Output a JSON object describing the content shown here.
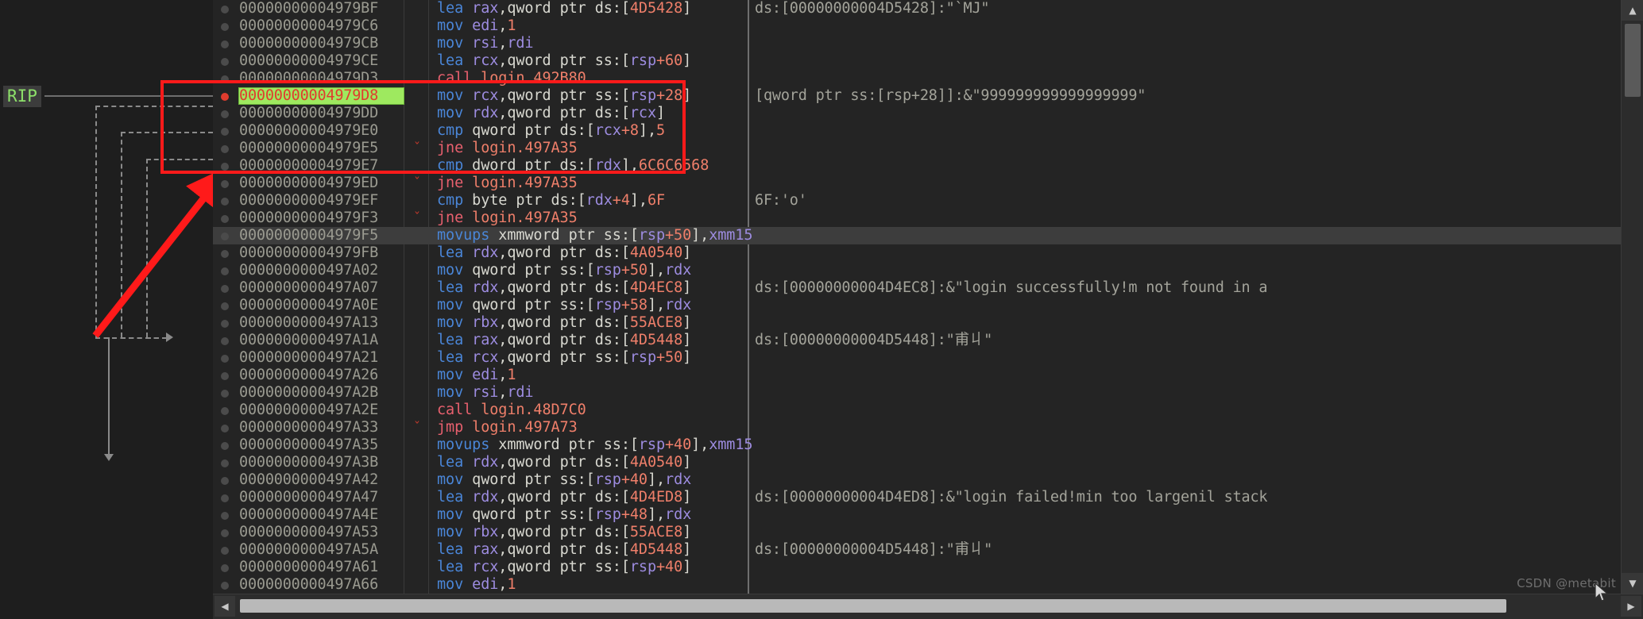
{
  "app": {
    "name": "x64dbg-disassembly-view",
    "watermark": "CSDN @metabit",
    "rip_label": "RIP"
  },
  "colors": {
    "background": "#242424",
    "margin_background": "#1e1e1e",
    "current_line_highlight": "#9ee95f",
    "current_line_text": "#e03c2e",
    "selected_row": "#3d3d3d",
    "annotation_red": "#ff1a1a",
    "breakpoint_active": "#e03c2e",
    "mnemonic_blue": "#4a86d8",
    "mnemonic_red": "#e8606e",
    "register_purple": "#9d8ce0",
    "number_salmon": "#ef7f6a",
    "comment_gray": "#a3a39a"
  },
  "scrollbars": {
    "vertical": {
      "up": "▲",
      "down": "▼"
    },
    "horizontal": {
      "left": "◀",
      "right": "▶"
    }
  },
  "rows": [
    {
      "addr": "00000000004979BF",
      "chev": "",
      "mn": "lea",
      "mnc": "blue",
      "ops": [
        [
          "reg",
          "rax"
        ],
        [
          "punc",
          ","
        ],
        [
          "white",
          "qword ptr  ds:["
        ],
        [
          "num",
          "4D5428"
        ],
        [
          "white",
          "]"
        ]
      ],
      "cmt": "ds:[00000000004D5428]:\"`MJ\""
    },
    {
      "addr": "00000000004979C6",
      "chev": "",
      "mn": "mov",
      "mnc": "blue",
      "ops": [
        [
          "reg",
          "edi"
        ],
        [
          "punc",
          ","
        ],
        [
          "num",
          "1"
        ]
      ],
      "cmt": ""
    },
    {
      "addr": "00000000004979CB",
      "chev": "",
      "mn": "mov",
      "mnc": "blue",
      "ops": [
        [
          "reg",
          "rsi"
        ],
        [
          "punc",
          ","
        ],
        [
          "reg",
          "rdi"
        ]
      ],
      "cmt": ""
    },
    {
      "addr": "00000000004979CE",
      "chev": "",
      "mn": "lea",
      "mnc": "blue",
      "ops": [
        [
          "reg",
          "rcx"
        ],
        [
          "punc",
          ","
        ],
        [
          "white",
          "qword ptr  ss:["
        ],
        [
          "reg",
          "rsp"
        ],
        [
          "num",
          "+60"
        ],
        [
          "white",
          "]"
        ]
      ],
      "cmt": ""
    },
    {
      "addr": "00000000004979D3",
      "chev": "",
      "mn": "call",
      "mnc": "red",
      "ops": [
        [
          "sym",
          "login.492B80"
        ]
      ],
      "cmt": ""
    },
    {
      "addr": "00000000004979D8",
      "chev": "",
      "mn": "mov",
      "mnc": "blue",
      "ops": [
        [
          "reg",
          "rcx"
        ],
        [
          "punc",
          ","
        ],
        [
          "white",
          "qword ptr  ss:["
        ],
        [
          "reg",
          "rsp"
        ],
        [
          "num",
          "+28"
        ],
        [
          "white",
          "]"
        ]
      ],
      "cmt": "[qword ptr ss:[rsp+28]]:&\"999999999999999999\"",
      "current": true,
      "bp": true
    },
    {
      "addr": "00000000004979DD",
      "chev": "",
      "mn": "mov",
      "mnc": "blue",
      "ops": [
        [
          "reg",
          "rdx"
        ],
        [
          "punc",
          ","
        ],
        [
          "white",
          "qword ptr  ds:["
        ],
        [
          "reg",
          "rcx"
        ],
        [
          "white",
          "]"
        ]
      ],
      "cmt": ""
    },
    {
      "addr": "00000000004979E0",
      "chev": "",
      "mn": "cmp",
      "mnc": "blue",
      "ops": [
        [
          "white",
          "qword ptr  ds:["
        ],
        [
          "reg",
          "rcx"
        ],
        [
          "num",
          "+8"
        ],
        [
          "white",
          "],"
        ],
        [
          "num",
          "5"
        ]
      ],
      "cmt": ""
    },
    {
      "addr": "00000000004979E5",
      "chev": "ˇ",
      "mn": "jne",
      "mnc": "red",
      "ops": [
        [
          "sym",
          "login.497A35"
        ]
      ],
      "cmt": ""
    },
    {
      "addr": "00000000004979E7",
      "chev": "",
      "mn": "cmp",
      "mnc": "blue",
      "ops": [
        [
          "white",
          "dword ptr  ds:["
        ],
        [
          "reg",
          "rdx"
        ],
        [
          "white",
          "],"
        ],
        [
          "num",
          "6C6C6568"
        ]
      ],
      "cmt": ""
    },
    {
      "addr": "00000000004979ED",
      "chev": "ˇ",
      "mn": "jne",
      "mnc": "red",
      "ops": [
        [
          "sym",
          "login.497A35"
        ]
      ],
      "cmt": ""
    },
    {
      "addr": "00000000004979EF",
      "chev": "",
      "mn": "cmp",
      "mnc": "blue",
      "ops": [
        [
          "white",
          "byte ptr  ds:["
        ],
        [
          "reg",
          "rdx"
        ],
        [
          "num",
          "+4"
        ],
        [
          "white",
          "],"
        ],
        [
          "num",
          "6F"
        ]
      ],
      "cmt": "6F:'o'"
    },
    {
      "addr": "00000000004979F3",
      "chev": "ˇ",
      "mn": "jne",
      "mnc": "red",
      "ops": [
        [
          "sym",
          "login.497A35"
        ]
      ],
      "cmt": ""
    },
    {
      "addr": "00000000004979F5",
      "chev": "",
      "mn": "movups",
      "mnc": "blue",
      "ops": [
        [
          "white",
          "xmmword ptr  ss:["
        ],
        [
          "reg",
          "rsp"
        ],
        [
          "num",
          "+50"
        ],
        [
          "white",
          "],"
        ],
        [
          "reg",
          "xmm15"
        ]
      ],
      "cmt": "",
      "selected": true
    },
    {
      "addr": "00000000004979FB",
      "chev": "",
      "mn": "lea",
      "mnc": "blue",
      "ops": [
        [
          "reg",
          "rdx"
        ],
        [
          "punc",
          ","
        ],
        [
          "white",
          "qword ptr  ds:["
        ],
        [
          "num",
          "4A0540"
        ],
        [
          "white",
          "]"
        ]
      ],
      "cmt": ""
    },
    {
      "addr": "0000000000497A02",
      "chev": "",
      "mn": "mov",
      "mnc": "blue",
      "ops": [
        [
          "white",
          "qword ptr  ss:["
        ],
        [
          "reg",
          "rsp"
        ],
        [
          "num",
          "+50"
        ],
        [
          "white",
          "],"
        ],
        [
          "reg",
          "rdx"
        ]
      ],
      "cmt": ""
    },
    {
      "addr": "0000000000497A07",
      "chev": "",
      "mn": "lea",
      "mnc": "blue",
      "ops": [
        [
          "reg",
          "rdx"
        ],
        [
          "punc",
          ","
        ],
        [
          "white",
          "qword ptr  ds:["
        ],
        [
          "num",
          "4D4EC8"
        ],
        [
          "white",
          "]"
        ]
      ],
      "cmt": "ds:[00000000004D4EC8]:&\"login successfully!m not found in a"
    },
    {
      "addr": "0000000000497A0E",
      "chev": "",
      "mn": "mov",
      "mnc": "blue",
      "ops": [
        [
          "white",
          "qword ptr  ss:["
        ],
        [
          "reg",
          "rsp"
        ],
        [
          "num",
          "+58"
        ],
        [
          "white",
          "],"
        ],
        [
          "reg",
          "rdx"
        ]
      ],
      "cmt": ""
    },
    {
      "addr": "0000000000497A13",
      "chev": "",
      "mn": "mov",
      "mnc": "blue",
      "ops": [
        [
          "reg",
          "rbx"
        ],
        [
          "punc",
          ","
        ],
        [
          "white",
          "qword ptr  ds:["
        ],
        [
          "num",
          "55ACE8"
        ],
        [
          "white",
          "]"
        ]
      ],
      "cmt": ""
    },
    {
      "addr": "0000000000497A1A",
      "chev": "",
      "mn": "lea",
      "mnc": "blue",
      "ops": [
        [
          "reg",
          "rax"
        ],
        [
          "punc",
          ","
        ],
        [
          "white",
          "qword ptr  ds:["
        ],
        [
          "num",
          "4D5448"
        ],
        [
          "white",
          "]"
        ]
      ],
      "cmt": "ds:[00000000004D5448]:\"甫丩\""
    },
    {
      "addr": "0000000000497A21",
      "chev": "",
      "mn": "lea",
      "mnc": "blue",
      "ops": [
        [
          "reg",
          "rcx"
        ],
        [
          "punc",
          ","
        ],
        [
          "white",
          "qword ptr  ss:["
        ],
        [
          "reg",
          "rsp"
        ],
        [
          "num",
          "+50"
        ],
        [
          "white",
          "]"
        ]
      ],
      "cmt": ""
    },
    {
      "addr": "0000000000497A26",
      "chev": "",
      "mn": "mov",
      "mnc": "blue",
      "ops": [
        [
          "reg",
          "edi"
        ],
        [
          "punc",
          ","
        ],
        [
          "num",
          "1"
        ]
      ],
      "cmt": ""
    },
    {
      "addr": "0000000000497A2B",
      "chev": "",
      "mn": "mov",
      "mnc": "blue",
      "ops": [
        [
          "reg",
          "rsi"
        ],
        [
          "punc",
          ","
        ],
        [
          "reg",
          "rdi"
        ]
      ],
      "cmt": ""
    },
    {
      "addr": "0000000000497A2E",
      "chev": "",
      "mn": "call",
      "mnc": "red",
      "ops": [
        [
          "sym",
          "login.48D7C0"
        ]
      ],
      "cmt": ""
    },
    {
      "addr": "0000000000497A33",
      "chev": "ˇ",
      "mn": "jmp",
      "mnc": "red",
      "ops": [
        [
          "sym",
          "login.497A73"
        ]
      ],
      "cmt": ""
    },
    {
      "addr": "0000000000497A35",
      "chev": "",
      "mn": "movups",
      "mnc": "blue",
      "ops": [
        [
          "white",
          "xmmword ptr  ss:["
        ],
        [
          "reg",
          "rsp"
        ],
        [
          "num",
          "+40"
        ],
        [
          "white",
          "],"
        ],
        [
          "reg",
          "xmm15"
        ]
      ],
      "cmt": ""
    },
    {
      "addr": "0000000000497A3B",
      "chev": "",
      "mn": "lea",
      "mnc": "blue",
      "ops": [
        [
          "reg",
          "rdx"
        ],
        [
          "punc",
          ","
        ],
        [
          "white",
          "qword ptr  ds:["
        ],
        [
          "num",
          "4A0540"
        ],
        [
          "white",
          "]"
        ]
      ],
      "cmt": ""
    },
    {
      "addr": "0000000000497A42",
      "chev": "",
      "mn": "mov",
      "mnc": "blue",
      "ops": [
        [
          "white",
          "qword ptr  ss:["
        ],
        [
          "reg",
          "rsp"
        ],
        [
          "num",
          "+40"
        ],
        [
          "white",
          "],"
        ],
        [
          "reg",
          "rdx"
        ]
      ],
      "cmt": ""
    },
    {
      "addr": "0000000000497A47",
      "chev": "",
      "mn": "lea",
      "mnc": "blue",
      "ops": [
        [
          "reg",
          "rdx"
        ],
        [
          "punc",
          ","
        ],
        [
          "white",
          "qword ptr  ds:["
        ],
        [
          "num",
          "4D4ED8"
        ],
        [
          "white",
          "]"
        ]
      ],
      "cmt": "ds:[00000000004D4ED8]:&\"login failed!min too largenil stack"
    },
    {
      "addr": "0000000000497A4E",
      "chev": "",
      "mn": "mov",
      "mnc": "blue",
      "ops": [
        [
          "white",
          "qword ptr  ss:["
        ],
        [
          "reg",
          "rsp"
        ],
        [
          "num",
          "+48"
        ],
        [
          "white",
          "],"
        ],
        [
          "reg",
          "rdx"
        ]
      ],
      "cmt": ""
    },
    {
      "addr": "0000000000497A53",
      "chev": "",
      "mn": "mov",
      "mnc": "blue",
      "ops": [
        [
          "reg",
          "rbx"
        ],
        [
          "punc",
          ","
        ],
        [
          "white",
          "qword ptr  ds:["
        ],
        [
          "num",
          "55ACE8"
        ],
        [
          "white",
          "]"
        ]
      ],
      "cmt": ""
    },
    {
      "addr": "0000000000497A5A",
      "chev": "",
      "mn": "lea",
      "mnc": "blue",
      "ops": [
        [
          "reg",
          "rax"
        ],
        [
          "punc",
          ","
        ],
        [
          "white",
          "qword ptr  ds:["
        ],
        [
          "num",
          "4D5448"
        ],
        [
          "white",
          "]"
        ]
      ],
      "cmt": "ds:[00000000004D5448]:\"甫丩\""
    },
    {
      "addr": "0000000000497A61",
      "chev": "",
      "mn": "lea",
      "mnc": "blue",
      "ops": [
        [
          "reg",
          "rcx"
        ],
        [
          "punc",
          ","
        ],
        [
          "white",
          "qword ptr  ss:["
        ],
        [
          "reg",
          "rsp"
        ],
        [
          "num",
          "+40"
        ],
        [
          "white",
          "]"
        ]
      ],
      "cmt": ""
    },
    {
      "addr": "0000000000497A66",
      "chev": "",
      "mn": "mov",
      "mnc": "blue",
      "ops": [
        [
          "reg",
          "edi"
        ],
        [
          "punc",
          ","
        ],
        [
          "num",
          "1"
        ]
      ],
      "cmt": ""
    }
  ]
}
